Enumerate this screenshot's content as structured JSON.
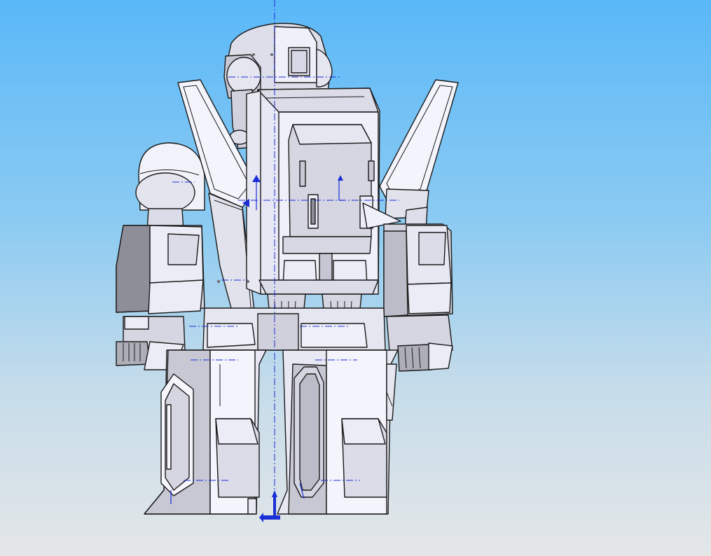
{
  "viewport": {
    "background_top": "#5ab8f8",
    "background_bottom": "#e4e6e8"
  },
  "model": {
    "face_light": "#ececf8",
    "face_mid": "#d6d6e2",
    "face_dark": "#aeaeb8",
    "face_shadow": "#8e8e98",
    "edge_color": "#1a1a1a",
    "construction_color": "#1a2fd6"
  },
  "icons": {
    "origin_triad": "origin-triad-icon",
    "sketch_point": "sketch-point-icon"
  }
}
